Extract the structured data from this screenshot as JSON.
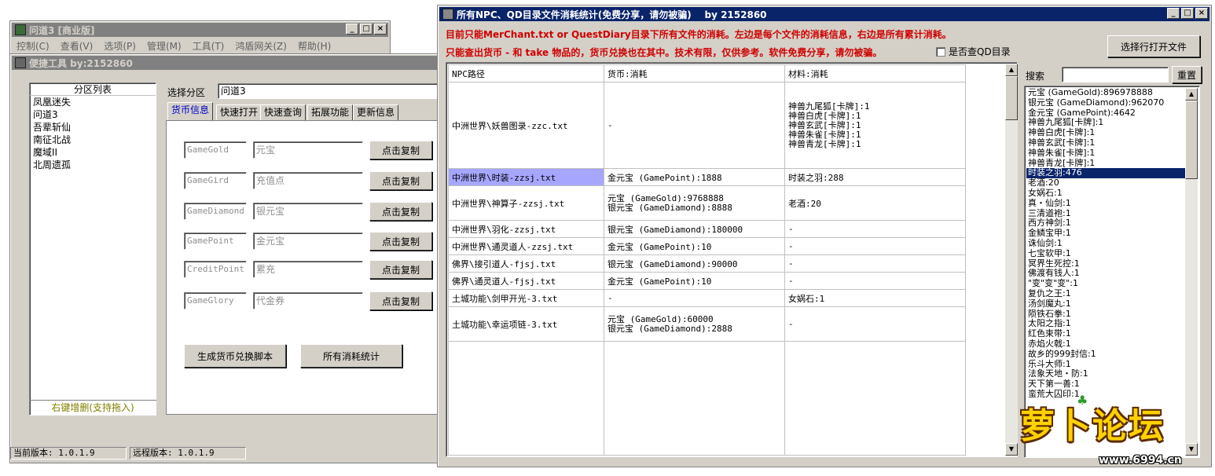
{
  "main_window": {
    "title": "问道3 [商业版]",
    "menu": [
      "控制(C)",
      "查看(V)",
      "选项(P)",
      "管理(M)",
      "工具(T)",
      "鸿盾网关(Z)",
      "帮助(H)"
    ]
  },
  "tool_window": {
    "title": "便捷工具   by:2152860",
    "partition_list_header": "分区列表",
    "partitions": [
      "凤凰迷失",
      "问道3",
      "吾辈斩仙",
      "南征北战",
      "魔域II",
      "北周遗孤"
    ],
    "partition_footer": "右键增删(支持拖入)",
    "select_label": "选择分区",
    "select_value": "问道3",
    "tabs": [
      "货币信息",
      "快速打开",
      "快速查询",
      "拓展功能",
      "更新信息"
    ],
    "currencies": [
      {
        "code": "GameGold",
        "name": "元宝",
        "button": "点击复制"
      },
      {
        "code": "GameGird",
        "name": "充值点",
        "button": "点击复制"
      },
      {
        "code": "GameDiamond",
        "name": "银元宝",
        "button": "点击复制"
      },
      {
        "code": "GamePoint",
        "name": "金元宝",
        "button": "点击复制"
      },
      {
        "code": "CreditPoint",
        "name": "累充",
        "button": "点击复制"
      },
      {
        "code": "GameGlory",
        "name": "代金券",
        "button": "点击复制"
      }
    ],
    "gen_script_button": "生成货币兑换脚本",
    "all_stats_button": "所有消耗统计",
    "current_version": "当前版本: 1.0.1.9",
    "remote_version": "远程版本: 1.0.1.9"
  },
  "stats_window": {
    "title": "所有NPC、QD目录文件消耗统计(免费分享，请勿被骗)    by 2152860",
    "notice_line1": "目前只能MerChant.txt or QuestDiary目录下所有文件的消耗。左边是每个文件的消耗信息，右边是所有累计消耗。",
    "notice_line2": "只能查出货币 - 和 take 物品的，货币兑换也在其中。技术有限，仅供参考。软件免费分享，请勿被骗。",
    "qd_checkbox_label": "是否查QD目录",
    "open_file_button": "选择行打开文件",
    "search_label": "搜索",
    "reset_button": "重置",
    "table_headers": [
      "NPC路径",
      "货币:消耗",
      "材料:消耗"
    ],
    "rows": [
      {
        "path": "中洲世界\\妖兽图录-zzc.txt",
        "currency": "-",
        "material": "神兽九尾狐[卡牌]:1\n神兽白虎[卡牌]:1\n神兽玄武[卡牌]:1\n神兽朱雀[卡牌]:1\n神兽青龙[卡牌]:1"
      },
      {
        "path": "中洲世界\\时装-zzsj.txt",
        "currency": "金元宝 (GamePoint):1888",
        "material": "时装之羽:288"
      },
      {
        "path": "中洲世界\\神算子-zzsj.txt",
        "currency": "元宝 (GameGold):9768888\n银元宝 (GameDiamond):8888",
        "material": "老酒:20"
      },
      {
        "path": "中洲世界\\羽化-zzsj.txt",
        "currency": "银元宝 (GameDiamond):180000",
        "material": "-"
      },
      {
        "path": "中洲世界\\通灵道人-zzsj.txt",
        "currency": "金元宝 (GamePoint):10",
        "material": "-"
      },
      {
        "path": "佛界\\接引道人-fjsj.txt",
        "currency": "银元宝 (GameDiamond):90000",
        "material": "-"
      },
      {
        "path": "佛界\\通灵道人-fjsj.txt",
        "currency": "金元宝 (GamePoint):10",
        "material": "-"
      },
      {
        "path": "土城功能\\剑甲开光-3.txt",
        "currency": "-",
        "material": "女娲石:1"
      },
      {
        "path": "土城功能\\幸运项链-3.txt",
        "currency": "元宝 (GameGold):60000\n银元宝 (GameDiamond):2888",
        "material": "-"
      }
    ],
    "summary": [
      "元宝 (GameGold):896978888",
      "银元宝 (GameDiamond):962070",
      "金元宝 (GamePoint):4642",
      "神兽九尾狐[卡牌]:1",
      "神兽白虎[卡牌]:1",
      "神兽玄武[卡牌]:1",
      "神兽朱雀[卡牌]:1",
      "神兽青龙[卡牌]:1",
      "时装之羽:476",
      "老酒:20",
      "女娲石:1",
      "真・仙剑:1",
      "三清道袍:1",
      "西方神剑:1",
      "金鳞宝甲:1",
      "诛仙剑:1",
      "七宝软甲:1",
      "冥界生死控:1",
      "佛渡有钱人:1",
      "\"变\"变\"变\":1",
      "复仇之王:1",
      "汤剑魔丸:1",
      "陨铁石拳:1",
      "太阳之指:1",
      "红色束带:1",
      "赤焰火戟:1",
      "故乡的999封信:1",
      "乐斗大师:1",
      "法象天地・防:1",
      "天下第一善:1",
      "蛮荒大囚印:1"
    ],
    "summary_selected_index": 8
  },
  "watermark": {
    "text": "萝卜论坛",
    "url": "www.6994.cn"
  }
}
